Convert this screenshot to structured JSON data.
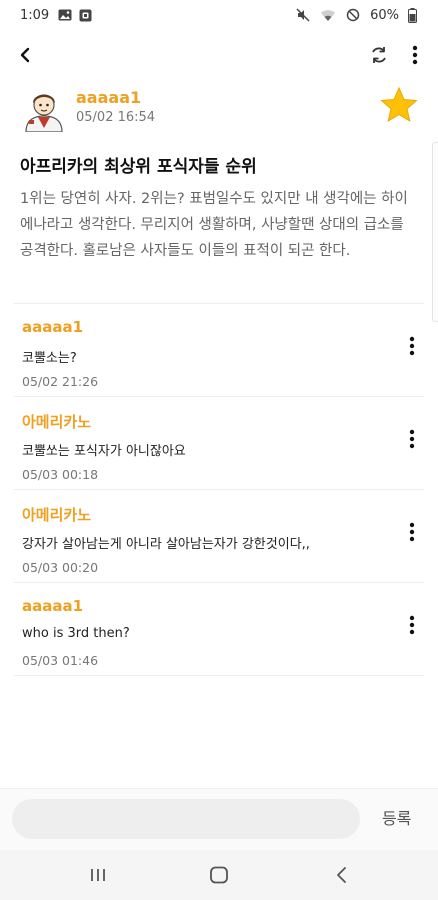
{
  "status_bar": {
    "time": "1:09",
    "battery": "60%",
    "icons": [
      "gallery-icon",
      "notification-icon",
      "mute-icon",
      "wifi-icon",
      "dnd-icon",
      "battery-icon"
    ]
  },
  "app_bar": {
    "icons": [
      "back-arrow-icon",
      "refresh-icon",
      "more-vertical-icon"
    ]
  },
  "post": {
    "author": "aaaaa1",
    "date": "05/02 16:54",
    "title": "아프리카의 최상위 포식자들 순위",
    "body": "1위는 당연히 사자. 2위는? 표범일수도 있지만 내 생각에는 하이에나라고 생각한다. 무리지어 생활하며, 사냥할땐 상대의 급소를 공격한다. 홀로남은 사자들도 이들의 표적이 되곤 한다.",
    "bookmarked_icon": "star-icon",
    "accent_color": "#f0a020"
  },
  "comments": [
    {
      "author": "aaaaa1",
      "text": "코뿔소는?",
      "date": "05/02 21:26"
    },
    {
      "author": "아메리카노",
      "text": "코뿔쏘는 포식자가 아니잖아요",
      "date": "05/03 00:18"
    },
    {
      "author": "아메리카노",
      "text": "강자가 살아남는게 아니라 살아남는자가 강한것이다,,",
      "date": "05/03 00:20"
    },
    {
      "author": "aaaaa1",
      "text": "who is 3rd then?",
      "date": "05/03 01:46"
    }
  ],
  "input": {
    "value": "",
    "placeholder": "",
    "submit_label": "등록"
  },
  "nav_bar": {
    "icons": [
      "recent-apps-icon",
      "home-icon",
      "back-icon"
    ]
  }
}
